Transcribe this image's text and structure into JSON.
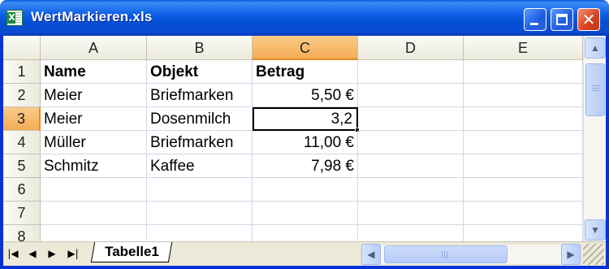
{
  "window": {
    "title": "WertMarkieren.xls",
    "icon": "excel-icon",
    "controls": {
      "minimize": "minimize-icon",
      "maximize": "maximize-icon",
      "close": "close-icon",
      "close_glyph": "✕"
    }
  },
  "sheet": {
    "columns": [
      "A",
      "B",
      "C",
      "D",
      "E"
    ],
    "selected_column": "C",
    "rows": [
      "1",
      "2",
      "3",
      "4",
      "5",
      "6",
      "7",
      "8"
    ],
    "selected_row": "3",
    "cells": [
      [
        "Name",
        "Objekt",
        "Betrag",
        "",
        ""
      ],
      [
        "Meier",
        "Briefmarken",
        "5,50 €",
        "",
        ""
      ],
      [
        "Meier",
        "Dosenmilch",
        "3,2",
        "",
        ""
      ],
      [
        "Müller",
        "Briefmarken",
        "11,00 €",
        "",
        ""
      ],
      [
        "Schmitz",
        "Kaffee",
        "7,98 €",
        "",
        ""
      ],
      [
        "",
        "",
        "",
        "",
        ""
      ],
      [
        "",
        "",
        "",
        "",
        ""
      ],
      [
        "",
        "",
        "",
        "",
        ""
      ]
    ],
    "active_cell": "C3"
  },
  "tabs": {
    "nav": [
      "|◀",
      "◀",
      "▶",
      "▶|"
    ],
    "sheets": [
      "Tabelle1"
    ],
    "active": "Tabelle1"
  },
  "scroll": {
    "up": "▲",
    "down": "▼",
    "left": "◀",
    "right": "▶"
  }
}
